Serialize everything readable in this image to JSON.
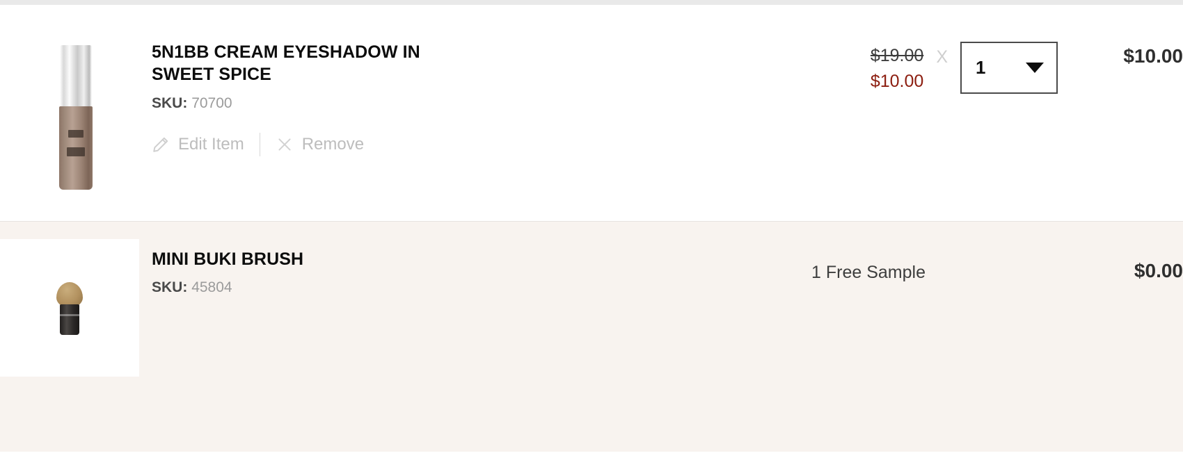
{
  "cart": {
    "rows": [
      {
        "type": "product",
        "thumbnail_icon": "cream-eyeshadow-tube-image",
        "title": "5N1BB CREAM EYESHADOW IN SWEET SPICE",
        "sku_label": "SKU:",
        "sku_value": "70700",
        "actions": {
          "edit_label": "Edit Item",
          "edit_icon": "pencil-icon",
          "remove_label": "Remove",
          "remove_icon": "x-icon"
        },
        "price_original": "$19.00",
        "price_sale": "$10.00",
        "multiply_symbol": "X",
        "quantity": "1",
        "quantity_caret_icon": "chevron-down-icon",
        "line_total": "$10.00"
      },
      {
        "type": "sample",
        "thumbnail_icon": "kabuki-brush-image",
        "title": "MINI BUKI BRUSH",
        "sku_label": "SKU:",
        "sku_value": "45804",
        "free_sample_note": "1 Free Sample",
        "line_total": "$0.00"
      }
    ]
  },
  "colors": {
    "sale_price": "#8c1d0f",
    "sample_row_background": "#f8f3ef",
    "product_row_background": "#ffffff",
    "divider": "#e9e9e9",
    "muted_text": "#bdbdbd"
  }
}
